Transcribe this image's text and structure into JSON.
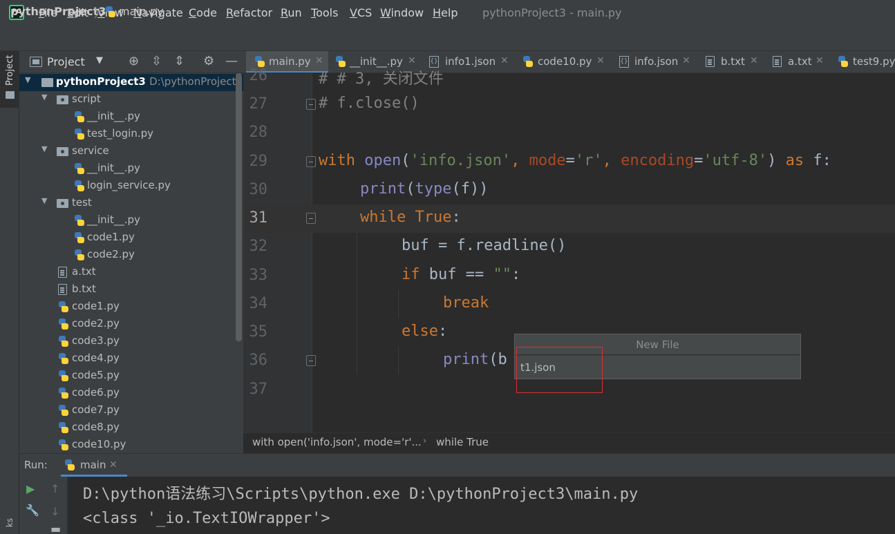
{
  "menu": {
    "items": [
      "File",
      "Edit",
      "View",
      "Navigate",
      "Code",
      "Refactor",
      "Run",
      "Tools",
      "VCS",
      "Window",
      "Help"
    ],
    "window_title": "pythonProject3 - main.py",
    "logo_text": "PC"
  },
  "breadcrumb": {
    "project": "pythonProject3",
    "separator": "〉",
    "file": "main.py"
  },
  "left_strip": {
    "project_label": "Project",
    "bottom_label": "ks"
  },
  "project_panel": {
    "title": "Project",
    "root": {
      "name": "pythonProject3",
      "path": "D:\\pythonProject3"
    },
    "tree": [
      {
        "label": "script"
      },
      {
        "label": "__init__.py"
      },
      {
        "label": "test_login.py"
      },
      {
        "label": "service"
      },
      {
        "label": "__init__.py"
      },
      {
        "label": "login_service.py"
      },
      {
        "label": "test"
      },
      {
        "label": "__init__.py"
      },
      {
        "label": "code1.py"
      },
      {
        "label": "code2.py"
      },
      {
        "label": "a.txt"
      },
      {
        "label": "b.txt"
      },
      {
        "label": "code1.py"
      },
      {
        "label": "code2.py"
      },
      {
        "label": "code3.py"
      },
      {
        "label": "code4.py"
      },
      {
        "label": "code5.py"
      },
      {
        "label": "code6.py"
      },
      {
        "label": "code7.py"
      },
      {
        "label": "code8.py"
      },
      {
        "label": "code10.py"
      }
    ]
  },
  "tabs": [
    {
      "label": "main.py",
      "icon": "python-file-icon",
      "active": true
    },
    {
      "label": "__init__.py",
      "icon": "python-file-icon",
      "active": false
    },
    {
      "label": "info1.json",
      "icon": "json-file-icon",
      "active": false
    },
    {
      "label": "code10.py",
      "icon": "python-file-icon",
      "active": false
    },
    {
      "label": "info.json",
      "icon": "json-file-icon",
      "active": false
    },
    {
      "label": "b.txt",
      "icon": "text-file-icon",
      "active": false
    },
    {
      "label": "a.txt",
      "icon": "text-file-icon",
      "active": false
    },
    {
      "label": "test9.py",
      "icon": "python-file-icon",
      "active": false
    }
  ],
  "editor": {
    "current_line": "31",
    "line_numbers": [
      "26",
      "27",
      "28",
      "29",
      "30",
      "31",
      "32",
      "33",
      "34",
      "35",
      "36",
      "37"
    ],
    "lines": {
      "l26": "# # 3, 关闭文件",
      "l27": "# f.close()",
      "l29_with": "with",
      "l29_open": "open",
      "l29_p1": "(",
      "l29_s1": "'info.json'",
      "l29_c1": ", ",
      "l29_k1": "mode",
      "l29_eq1": "=",
      "l29_s2": "'r'",
      "l29_c2": ", ",
      "l29_k2": "encoding",
      "l29_eq2": "=",
      "l29_s3": "'utf-8'",
      "l29_p2": ") ",
      "l29_as": "as",
      "l29_f": " f:",
      "l30_print": "print",
      "l30_p1": "(",
      "l30_type": "type",
      "l30_rest": "(f))",
      "l31_while": "while",
      "l31_true": "True",
      "l31_colon": ":",
      "l32": "buf = f.readline()",
      "l33_if": "if",
      "l33_rest": " buf == ",
      "l33_str": "\"\"",
      "l33_colon": ":",
      "l34": "break",
      "l35_else": "else",
      "l35_colon": ":",
      "l36_print": "print",
      "l36_rest": "(b"
    }
  },
  "editor_breadcrumb": {
    "context": "with open('info.json', mode='r'...",
    "arrow": "›",
    "scope": "while True"
  },
  "new_file_popup": {
    "title": "New File",
    "value": "t1.json"
  },
  "run_panel": {
    "label": "Run:",
    "tab": "main",
    "console": [
      "D:\\python语法练习\\Scripts\\python.exe D:\\pythonProject3\\main.py",
      "<class '_io.TextIOWrapper'>"
    ]
  },
  "colors": {
    "accent": "#4a88c7",
    "highlight_box": "#e0302f",
    "keyword": "#cc7832",
    "string": "#6a8759",
    "builtin": "#8888c6"
  }
}
